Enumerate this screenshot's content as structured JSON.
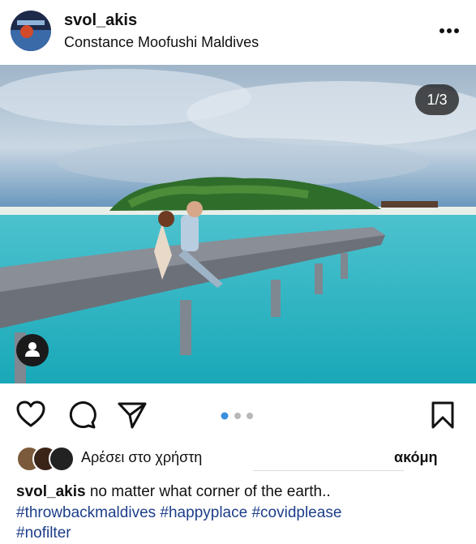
{
  "post": {
    "username": "svol_akis",
    "location": "Constance Moofushi Maldives",
    "counter": "1/3",
    "dots": {
      "total": 3,
      "active": 1
    }
  },
  "likes": {
    "text": "Αρέσει στο χρήστη",
    "more": "ακόμη"
  },
  "caption": {
    "username": "svol_akis",
    "text": "no matter what corner of the earth..",
    "hashtags": [
      "#throwbackmaldives",
      "#happyplace",
      "#covidplease",
      "#nofilter"
    ]
  },
  "colors": {
    "accent_dot": "#3a8fdd",
    "hashtag": "#1d3e8a"
  },
  "icons": [
    "more-options-icon",
    "heart-icon",
    "comment-icon",
    "share-icon",
    "bookmark-icon",
    "person-tag-icon"
  ]
}
